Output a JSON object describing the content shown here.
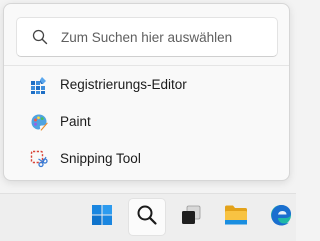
{
  "search": {
    "placeholder": "Zum Suchen hier auswählen",
    "icon": "search-icon"
  },
  "apps": [
    {
      "label": "Registrierungs-Editor",
      "icon": "registry-editor-icon"
    },
    {
      "label": "Paint",
      "icon": "paint-icon"
    },
    {
      "label": "Snipping Tool",
      "icon": "snipping-tool-icon"
    }
  ],
  "taskbar": {
    "items": [
      {
        "icon": "windows-start-icon"
      },
      {
        "icon": "search-icon",
        "active": true
      },
      {
        "icon": "task-view-icon"
      },
      {
        "icon": "file-explorer-icon"
      },
      {
        "icon": "edge-icon"
      }
    ]
  },
  "colors": {
    "start_blue": "#0078d4",
    "explorer_yellow": "#f8c342",
    "edge_teal": "#1fb8a6"
  }
}
